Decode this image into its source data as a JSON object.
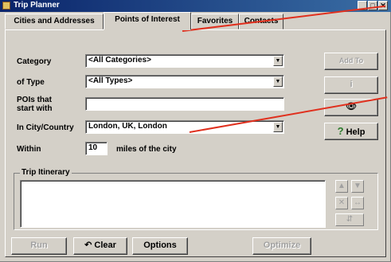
{
  "window": {
    "title": "Trip Planner",
    "controls": {
      "minimize": "_",
      "maximize": "□",
      "close": "✕"
    }
  },
  "tabs": [
    {
      "label": "Cities and Addresses",
      "active": false
    },
    {
      "label": "Points of Interest",
      "active": true
    },
    {
      "label": "Favorites",
      "active": false
    },
    {
      "label": "Contacts",
      "active": false
    }
  ],
  "form": {
    "category": {
      "label": "Category",
      "value": "<All Categories>"
    },
    "type": {
      "label": "of Type",
      "value": "<All Types>"
    },
    "starts_with": {
      "label": "POIs that start with",
      "value": ""
    },
    "city": {
      "label": "In City/Country",
      "value": "London, UK, London"
    },
    "within": {
      "label": "Within",
      "value": "10",
      "suffix": "miles of the city"
    }
  },
  "side_buttons": {
    "add": "Add To",
    "info": "i",
    "find": "👁",
    "help": "Help",
    "help_icon": "?"
  },
  "itinerary": {
    "title": "Trip Itinerary",
    "items": []
  },
  "itinerary_controls": [
    "▲",
    "▼",
    "✕",
    "↔",
    "⇵"
  ],
  "bottom_buttons": {
    "run": "Run",
    "clear": "Clear",
    "options": "Options",
    "optimize": "Optimize"
  },
  "icons": {
    "clear": "↶",
    "combo_arrow": "▼"
  },
  "colors": {
    "title_bar": "#0a246a",
    "callout": "#e0301e",
    "help_icon": "#2a7a2a"
  }
}
